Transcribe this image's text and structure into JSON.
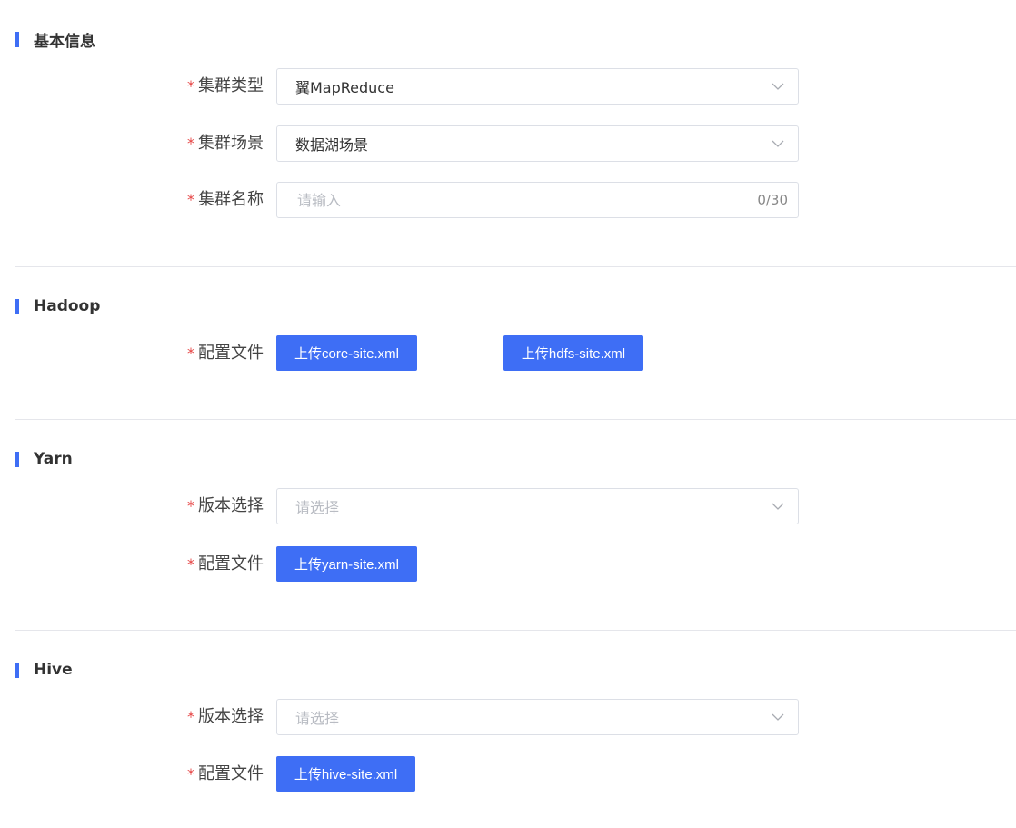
{
  "sections": {
    "basic": {
      "title": "基本信息",
      "cluster_type": {
        "label": "集群类型",
        "value": "翼MapReduce"
      },
      "cluster_scenario": {
        "label": "集群场景",
        "value": "数据湖场景"
      },
      "cluster_name": {
        "label": "集群名称",
        "placeholder": "请输入",
        "value": "",
        "counter": "0/30"
      }
    },
    "hadoop": {
      "title": "Hadoop",
      "config_label": "配置文件",
      "upload_core": "上传core-site.xml",
      "upload_hdfs": "上传hdfs-site.xml"
    },
    "yarn": {
      "title": "Yarn",
      "version_label": "版本选择",
      "version_placeholder": "请选择",
      "config_label": "配置文件",
      "upload_yarn": "上传yarn-site.xml"
    },
    "hive": {
      "title": "Hive",
      "version_label": "版本选择",
      "version_placeholder": "请选择",
      "config_label": "配置文件",
      "upload_hive": "上传hive-site.xml"
    }
  },
  "required_mark": "*",
  "icons": {
    "dropdown": "chevron-down-icon"
  },
  "colors": {
    "accent": "#3e6ef5",
    "required": "#e64545",
    "border": "#dcdfe6",
    "divider": "#e5e6eb",
    "placeholder": "#b9bcc3"
  }
}
